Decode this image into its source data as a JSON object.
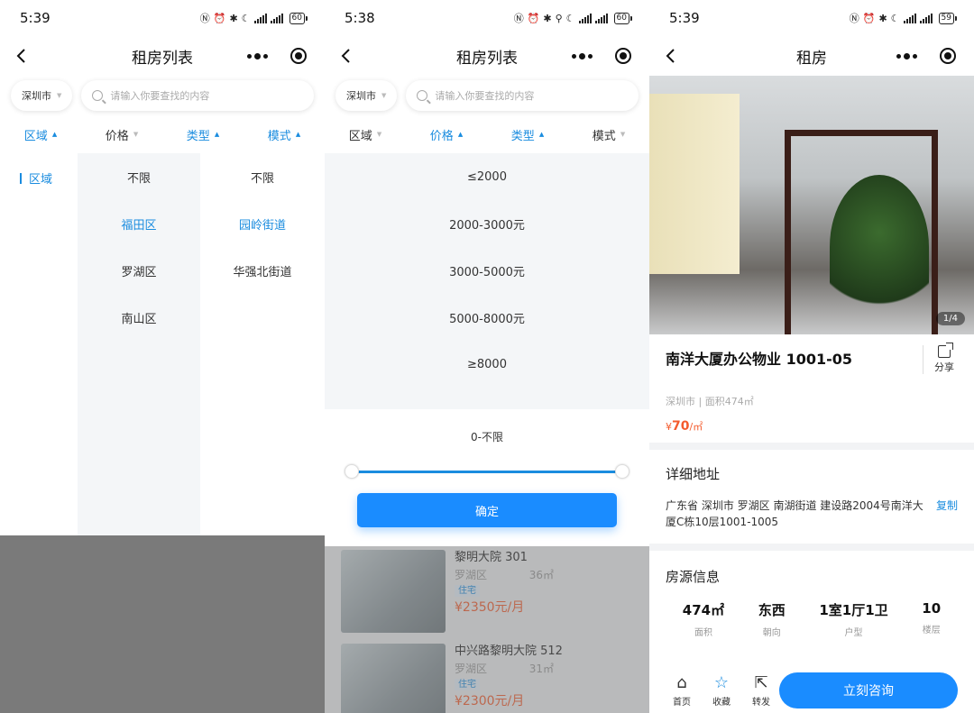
{
  "screen1": {
    "time": "5:39",
    "battery": "60",
    "title": "租房列表",
    "city": "深圳市",
    "search_placeholder": "请输入你要查找的内容",
    "filters": [
      "区域",
      "价格",
      "类型",
      "模式"
    ],
    "level1": "区域",
    "districts": [
      "不限",
      "福田区",
      "罗湖区",
      "南山区"
    ],
    "streets": [
      "不限",
      "园岭街道",
      "华强北街道"
    ]
  },
  "screen2": {
    "time": "5:38",
    "battery": "60",
    "title": "租房列表",
    "city": "深圳市",
    "search_placeholder": "请输入你要查找的内容",
    "filters": [
      "区域",
      "价格",
      "类型",
      "模式"
    ],
    "prices": [
      "≤2000",
      "2000-3000元",
      "3000-5000元",
      "5000-8000元",
      "≥8000"
    ],
    "range_label": "0-不限",
    "confirm": "确定",
    "listings": [
      {
        "name": "黎明大院 301",
        "district": "罗湖区",
        "area": "36㎡",
        "tag": "住宅",
        "price": "¥2350元/月"
      },
      {
        "name": "中兴路黎明大院 512",
        "district": "罗湖区",
        "area": "31㎡",
        "tag": "住宅",
        "price": "¥2300元/月"
      }
    ]
  },
  "screen3": {
    "time": "5:39",
    "battery": "59",
    "title": "租房",
    "photo_counter": "1/4",
    "property_name": "南洋大厦办公物业 1001-05",
    "share": "分享",
    "meta": "深圳市 | 面积474㎡",
    "price_prefix": "¥",
    "price_value": "70",
    "price_unit": "/㎡",
    "address_title": "详细地址",
    "address": "广东省 深圳市 罗湖区 南湖街道 建设路2004号南洋大厦C栋10层1001-1005",
    "copy": "复制",
    "info_title": "房源信息",
    "stats": [
      {
        "value": "474㎡",
        "label": "面积"
      },
      {
        "value": "东西",
        "label": "朝向"
      },
      {
        "value": "1室1厅1卫",
        "label": "户型"
      },
      {
        "value": "10",
        "label": "楼层"
      }
    ],
    "tabs": [
      "首页",
      "收藏",
      "转发"
    ],
    "consult": "立刻咨询"
  },
  "colors": {
    "accent": "#1a8cdf",
    "price": "#f45b2d",
    "button": "#1a8cff"
  }
}
